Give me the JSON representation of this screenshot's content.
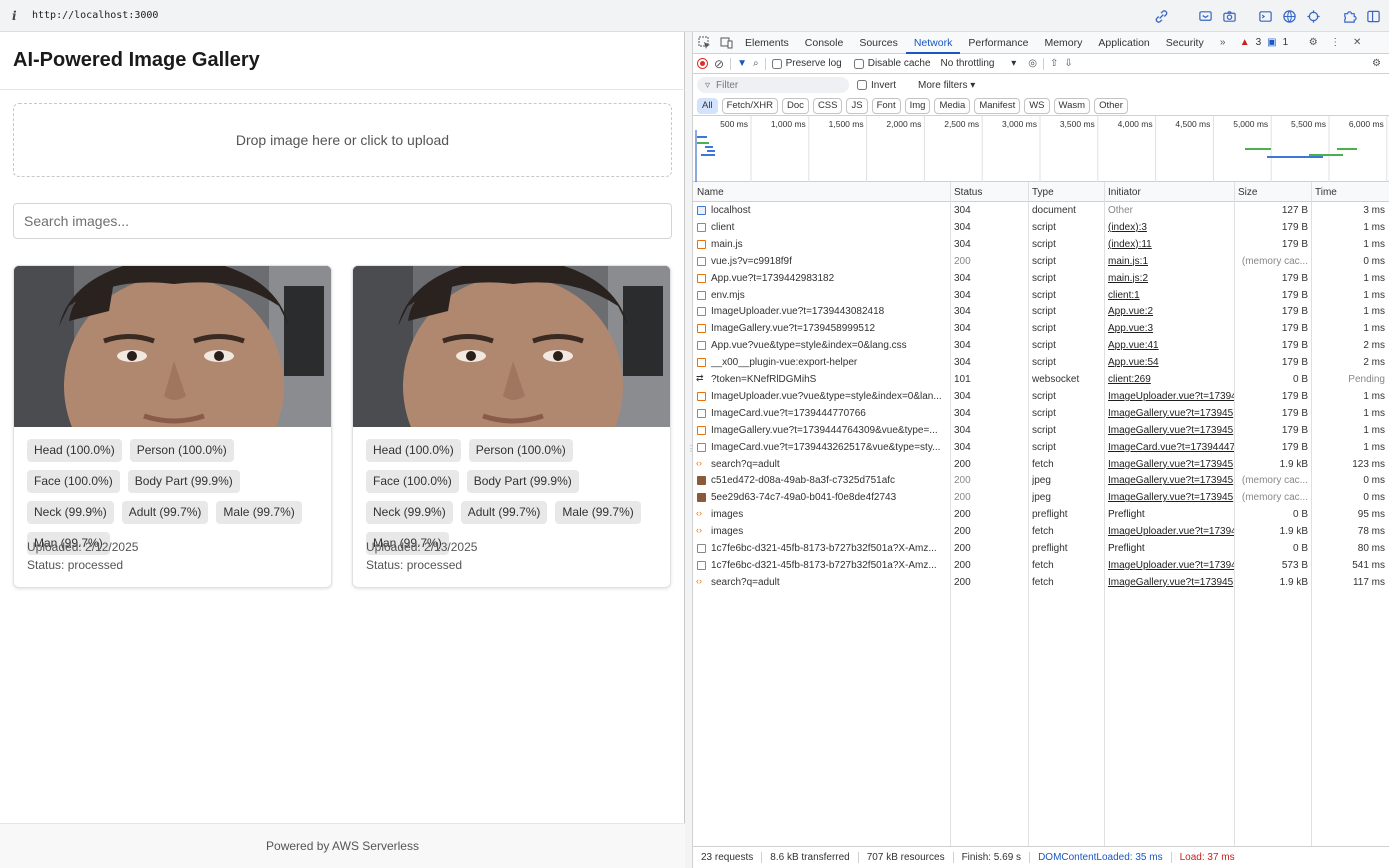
{
  "browser": {
    "url": "http://localhost:3000",
    "info_glyph": "i"
  },
  "app": {
    "title": "AI-Powered Image Gallery",
    "drop_text": "Drop image here or click to upload",
    "search_placeholder": "Search images...",
    "footer": "Powered by AWS Serverless",
    "cards": [
      {
        "tags": [
          "Head (100.0%)",
          "Person (100.0%)",
          "Face (100.0%)",
          "Body Part (99.9%)",
          "Neck (99.9%)",
          "Adult (99.7%)",
          "Male (99.7%)",
          "Man (99.7%)"
        ],
        "uploaded": "Uploaded: 2/12/2025",
        "status": "Status: processed"
      },
      {
        "tags": [
          "Head (100.0%)",
          "Person (100.0%)",
          "Face (100.0%)",
          "Body Part (99.9%)",
          "Neck (99.9%)",
          "Adult (99.7%)",
          "Male (99.7%)",
          "Man (99.7%)"
        ],
        "uploaded": "Uploaded: 2/13/2025",
        "status": "Status: processed"
      }
    ]
  },
  "devtools": {
    "tabs": [
      "Elements",
      "Console",
      "Sources",
      "Network",
      "Performance",
      "Memory",
      "Application",
      "Security"
    ],
    "active_tab": "Network",
    "warnings": "3",
    "messages": "1",
    "preserve_log": "Preserve log",
    "disable_cache": "Disable cache",
    "throttling": "No throttling",
    "filter_placeholder": "Filter",
    "invert": "Invert",
    "more_filters": "More filters",
    "types": [
      "All",
      "Fetch/XHR",
      "Doc",
      "CSS",
      "JS",
      "Font",
      "Img",
      "Media",
      "Manifest",
      "WS",
      "Wasm",
      "Other"
    ],
    "timeline_ticks": [
      "500 ms",
      "1,000 ms",
      "1,500 ms",
      "2,000 ms",
      "2,500 ms",
      "3,000 ms",
      "3,500 ms",
      "4,000 ms",
      "4,500 ms",
      "5,000 ms",
      "5,500 ms",
      "6,000 ms"
    ],
    "columns": {
      "name": "Name",
      "status": "Status",
      "type": "Type",
      "initiator": "Initiator",
      "size": "Size",
      "time": "Time"
    },
    "requests": [
      {
        "icon": "doc",
        "name": "localhost",
        "status": "304",
        "type": "document",
        "initiator": "Other",
        "init_plain": true,
        "size": "127 B",
        "time": "3 ms"
      },
      {
        "icon": "js",
        "name": "client",
        "status": "304",
        "type": "script",
        "initiator": "(index):3",
        "size": "179 B",
        "time": "1 ms"
      },
      {
        "icon": "js",
        "name": "main.js",
        "status": "304",
        "type": "script",
        "initiator": "(index):11",
        "size": "179 B",
        "time": "1 ms"
      },
      {
        "icon": "js",
        "name": "vue.js?v=c9918f9f",
        "status": "200",
        "status_gray": true,
        "type": "script",
        "initiator": "main.js:1",
        "size": "(memory cac...",
        "size_gray": true,
        "time": "0 ms"
      },
      {
        "icon": "js",
        "name": "App.vue?t=1739442983182",
        "status": "304",
        "type": "script",
        "initiator": "main.js:2",
        "size": "179 B",
        "time": "1 ms"
      },
      {
        "icon": "js",
        "name": "env.mjs",
        "status": "304",
        "type": "script",
        "initiator": "client:1",
        "size": "179 B",
        "time": "1 ms"
      },
      {
        "icon": "js",
        "name": "ImageUploader.vue?t=1739443082418",
        "status": "304",
        "type": "script",
        "initiator": "App.vue:2",
        "size": "179 B",
        "time": "1 ms"
      },
      {
        "icon": "js",
        "name": "ImageGallery.vue?t=1739458999512",
        "status": "304",
        "type": "script",
        "initiator": "App.vue:3",
        "size": "179 B",
        "time": "1 ms"
      },
      {
        "icon": "js",
        "name": "App.vue?vue&type=style&index=0&lang.css",
        "status": "304",
        "type": "script",
        "initiator": "App.vue:41",
        "size": "179 B",
        "time": "2 ms"
      },
      {
        "icon": "js",
        "name": "__x00__plugin-vue:export-helper",
        "status": "304",
        "type": "script",
        "initiator": "App.vue:54",
        "size": "179 B",
        "time": "2 ms"
      },
      {
        "icon": "ws",
        "name": "?token=KNefRlDGMihS",
        "status": "101",
        "type": "websocket",
        "initiator": "client:269",
        "size": "0 B",
        "time": "Pending",
        "time_gray": true
      },
      {
        "icon": "js",
        "name": "ImageUploader.vue?vue&type=style&index=0&lan...",
        "status": "304",
        "type": "script",
        "initiator": "ImageUploader.vue?t=17394",
        "size": "179 B",
        "time": "1 ms"
      },
      {
        "icon": "js",
        "name": "ImageCard.vue?t=1739444770766",
        "status": "304",
        "type": "script",
        "initiator": "ImageGallery.vue?t=173945",
        "size": "179 B",
        "time": "1 ms"
      },
      {
        "icon": "js",
        "name": "ImageGallery.vue?t=1739444764309&vue&type=...",
        "status": "304",
        "type": "script",
        "initiator": "ImageGallery.vue?t=173945",
        "size": "179 B",
        "time": "1 ms"
      },
      {
        "icon": "js",
        "name": "ImageCard.vue?t=1739443262517&vue&type=sty...",
        "status": "304",
        "type": "script",
        "initiator": "ImageCard.vue?t=17394447",
        "size": "179 B",
        "time": "1 ms"
      },
      {
        "icon": "fetch",
        "name": "search?q=adult",
        "status": "200",
        "type": "fetch",
        "initiator": "ImageGallery.vue?t=173945",
        "size": "1.9 kB",
        "time": "123 ms"
      },
      {
        "icon": "img",
        "name": "c51ed472-d08a-49ab-8a3f-c7325d751afc",
        "status": "200",
        "status_gray": true,
        "type": "jpeg",
        "initiator": "ImageGallery.vue?t=173945",
        "size": "(memory cac...",
        "size_gray": true,
        "time": "0 ms"
      },
      {
        "icon": "img",
        "name": "5ee29d63-74c7-49a0-b041-f0e8de4f2743",
        "status": "200",
        "status_gray": true,
        "type": "jpeg",
        "initiator": "ImageGallery.vue?t=173945",
        "size": "(memory cac...",
        "size_gray": true,
        "time": "0 ms"
      },
      {
        "icon": "fetch",
        "name": "images",
        "status": "200",
        "type": "preflight",
        "initiator": "Preflight",
        "init_plain_dark": true,
        "size": "0 B",
        "time": "95 ms"
      },
      {
        "icon": "fetch",
        "name": "images",
        "status": "200",
        "type": "fetch",
        "initiator": "ImageUploader.vue?t=17394",
        "size": "1.9 kB",
        "time": "78 ms"
      },
      {
        "icon": "blank",
        "name": "1c7fe6bc-d321-45fb-8173-b727b32f501a?X-Amz...",
        "status": "200",
        "type": "preflight",
        "initiator": "Preflight",
        "init_plain_dark": true,
        "size": "0 B",
        "time": "80 ms"
      },
      {
        "icon": "blank",
        "name": "1c7fe6bc-d321-45fb-8173-b727b32f501a?X-Amz...",
        "status": "200",
        "type": "fetch",
        "initiator": "ImageUploader.vue?t=17394",
        "size": "573 B",
        "time": "541 ms"
      },
      {
        "icon": "fetch",
        "name": "search?q=adult",
        "status": "200",
        "type": "fetch",
        "initiator": "ImageGallery.vue?t=173945",
        "size": "1.9 kB",
        "time": "117 ms"
      }
    ],
    "summary": {
      "requests": "23 requests",
      "transferred": "8.6 kB transferred",
      "resources": "707 kB resources",
      "finish": "Finish: 5.69 s",
      "dcl": "DOMContentLoaded: 35 ms",
      "load": "Load: 37 ms"
    }
  }
}
